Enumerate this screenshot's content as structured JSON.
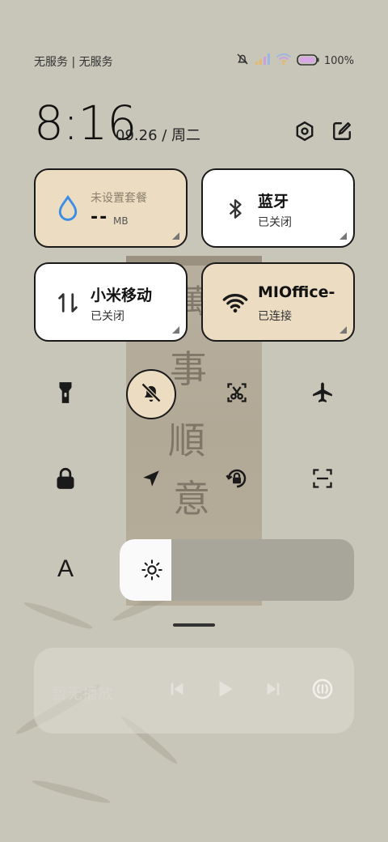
{
  "status_bar": {
    "carrier_text": "无服务 | 无服务",
    "battery_percent": "100%",
    "icons": [
      "bell-muted-icon",
      "signal-icon",
      "wifi-icon",
      "battery-icon"
    ]
  },
  "header": {
    "time": "8:16",
    "date": "09.26 / 周二",
    "settings_icon": "hexagon-settings-icon",
    "edit_icon": "edit-icon"
  },
  "tiles": {
    "data": {
      "title": "未设置套餐",
      "value": "--",
      "unit": "MB",
      "icon": "water-drop-icon",
      "state": "inactive"
    },
    "bluetooth": {
      "title": "蓝牙",
      "status": "已关闭",
      "icon": "bluetooth-icon",
      "state": "inactive"
    },
    "mobile": {
      "title": "小米移动",
      "status": "已关闭",
      "icon": "updown-arrows-icon",
      "state": "inactive"
    },
    "wifi": {
      "title": "MIOffice-",
      "status": "已连接",
      "icon": "wifi-icon",
      "state": "active"
    }
  },
  "toggles": [
    {
      "name": "flashlight",
      "icon": "flashlight-icon",
      "active": false
    },
    {
      "name": "mute",
      "icon": "bell-off-icon",
      "active": true
    },
    {
      "name": "screenshot",
      "icon": "scissors-icon",
      "active": false
    },
    {
      "name": "airplane",
      "icon": "airplane-icon",
      "active": false
    },
    {
      "name": "lock-screen",
      "icon": "lock-icon",
      "active": false
    },
    {
      "name": "location",
      "icon": "location-arrow-icon",
      "active": false
    },
    {
      "name": "rotation-lock",
      "icon": "rotation-lock-icon",
      "active": false
    },
    {
      "name": "scanner",
      "icon": "scan-icon",
      "active": false
    },
    {
      "name": "font-size",
      "icon": "font-a-icon",
      "label": "A",
      "active": false
    }
  ],
  "brightness": {
    "level_fraction": 0.22,
    "icon": "sun-icon"
  },
  "media": {
    "text": "暂无播放",
    "buttons": [
      "previous-icon",
      "play-icon",
      "next-icon",
      "cast-icon"
    ]
  },
  "colors": {
    "background": "#c8c6b9",
    "tile_active": "#ecdcc1",
    "tile_inactive": "#ffffff",
    "accent_blue": "#3a8ee6"
  }
}
